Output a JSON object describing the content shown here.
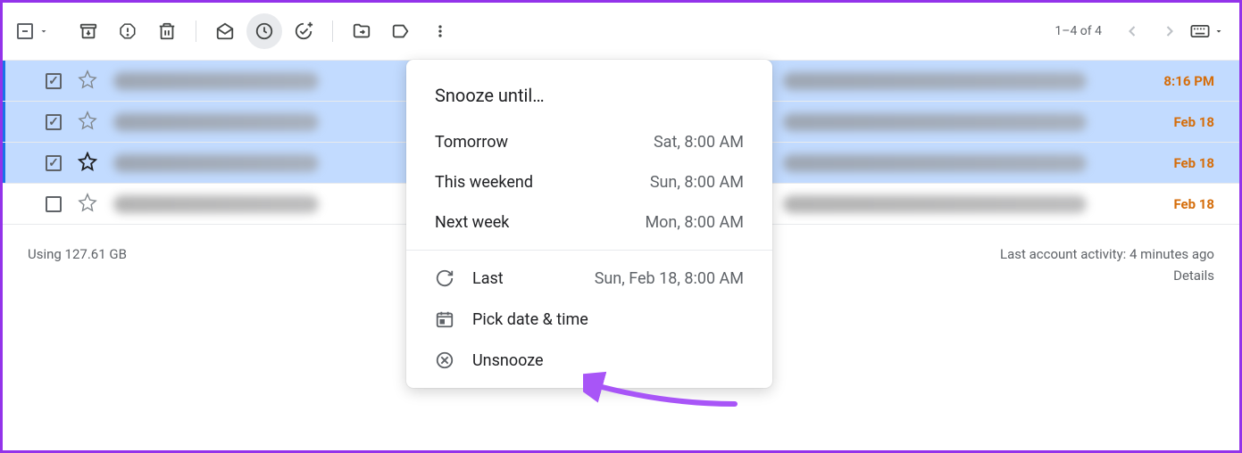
{
  "toolbar": {
    "icons": {
      "select": "select-checkbox",
      "archive": "archive-icon",
      "spam": "report-spam-icon",
      "delete": "trash-icon",
      "markUnread": "mail-open-icon",
      "snooze": "clock-icon",
      "addTask": "add-task-icon",
      "moveTo": "folder-move-icon",
      "labels": "label-icon",
      "more": "more-vert-icon"
    }
  },
  "pagination": {
    "text": "1–4 of 4"
  },
  "emails": [
    {
      "selected": true,
      "starred": false,
      "time": "8:16 PM"
    },
    {
      "selected": true,
      "starred": false,
      "time": "Feb 18"
    },
    {
      "selected": true,
      "starred": true,
      "time": "Feb 18"
    },
    {
      "selected": false,
      "starred": false,
      "time": "Feb 18"
    }
  ],
  "snoozeMenu": {
    "title": "Snooze until…",
    "options": [
      {
        "label": "Tomorrow",
        "time": "Sat, 8:00 AM"
      },
      {
        "label": "This weekend",
        "time": "Sun, 8:00 AM"
      },
      {
        "label": "Next week",
        "time": "Mon, 8:00 AM"
      }
    ],
    "last": {
      "label": "Last",
      "time": "Sun, Feb 18, 8:00 AM"
    },
    "pickDate": "Pick date & time",
    "unsnooze": "Unsnooze"
  },
  "footer": {
    "storage": "Using 127.61 GB",
    "activity": "Last account activity: 4 minutes ago",
    "details": "Details"
  }
}
